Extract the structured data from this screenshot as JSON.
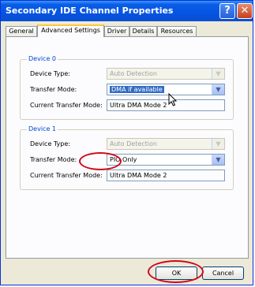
{
  "window": {
    "title": "Secondary IDE Channel Properties"
  },
  "titlebar": {
    "help_glyph": "?",
    "close_glyph": "✕"
  },
  "tabs": [
    {
      "label": "General"
    },
    {
      "label": "Advanced Settings"
    },
    {
      "label": "Driver"
    },
    {
      "label": "Details"
    },
    {
      "label": "Resources"
    }
  ],
  "device0": {
    "group_label": "Device 0",
    "device_type_label": "Device Type:",
    "device_type_value": "Auto Detection",
    "transfer_mode_label": "Transfer Mode:",
    "transfer_mode_value": "DMA if available",
    "current_transfer_label": "Current Transfer Mode:",
    "current_transfer_value": "Ultra DMA Mode 2"
  },
  "device1": {
    "group_label": "Device 1",
    "device_type_label": "Device Type:",
    "device_type_value": "Auto Detection",
    "transfer_mode_label": "Transfer Mode:",
    "transfer_mode_value": "PIO Only",
    "current_transfer_label": "Current Transfer Mode:",
    "current_transfer_value": "Ultra DMA Mode 2"
  },
  "buttons": {
    "ok": "OK",
    "cancel": "Cancel"
  },
  "icons": {
    "dropdown_arrow": "chevron-down-icon",
    "help": "help-icon",
    "close": "close-icon"
  },
  "colors": {
    "titlebar": "#0554e3",
    "annotation": "#d0091a",
    "selection": "#316ac5",
    "group_label": "#0046d5"
  }
}
